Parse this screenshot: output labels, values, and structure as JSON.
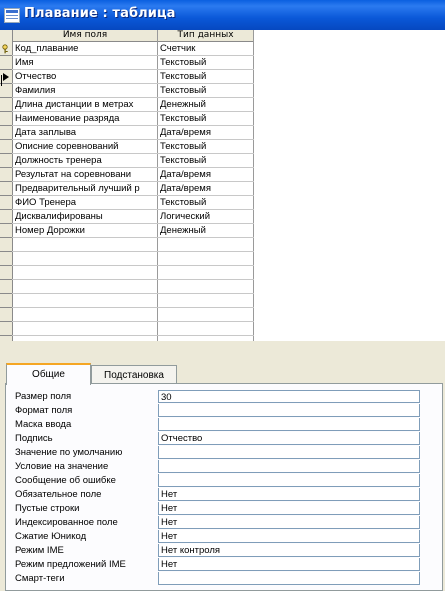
{
  "window": {
    "title": "Плавание : таблица"
  },
  "grid": {
    "columns": [
      "Имя поля",
      "Тип данных"
    ],
    "rows": [
      {
        "name": "Код_плавание",
        "type": "Счетчик"
      },
      {
        "name": "Имя",
        "type": "Текстовый"
      },
      {
        "name": "Отчество",
        "type": "Текстовый"
      },
      {
        "name": "Фамилия",
        "type": "Текстовый"
      },
      {
        "name": "Длина дистанции в метрах",
        "type": "Денежный"
      },
      {
        "name": "Наименование разряда",
        "type": "Текстовый"
      },
      {
        "name": "Дата заплыва",
        "type": "Дата/время"
      },
      {
        "name": "Описние соревнований",
        "type": "Текстовый"
      },
      {
        "name": "Должность тренера",
        "type": "Текстовый"
      },
      {
        "name": "Результат на соревновани",
        "type": "Дата/время"
      },
      {
        "name": "Предварительный лучший р",
        "type": "Дата/время"
      },
      {
        "name": "ФИО Тренера",
        "type": "Текстовый"
      },
      {
        "name": "Дисквалифированы",
        "type": "Логический"
      },
      {
        "name": "Номер Дорожки",
        "type": "Денежный"
      }
    ],
    "primary_key_row": 0,
    "current_row": 2
  },
  "tabs": {
    "general": "Общие",
    "lookup": "Подстановка"
  },
  "properties": [
    {
      "label": "Размер поля",
      "value": "30"
    },
    {
      "label": "Формат поля",
      "value": ""
    },
    {
      "label": "Маска ввода",
      "value": ""
    },
    {
      "label": "Подпись",
      "value": "Отчество"
    },
    {
      "label": "Значение по умолчанию",
      "value": ""
    },
    {
      "label": "Условие на значение",
      "value": ""
    },
    {
      "label": "Сообщение об ошибке",
      "value": ""
    },
    {
      "label": "Обязательное поле",
      "value": "Нет"
    },
    {
      "label": "Пустые строки",
      "value": "Нет"
    },
    {
      "label": "Индексированное поле",
      "value": "Нет"
    },
    {
      "label": "Сжатие Юникод",
      "value": "Нет"
    },
    {
      "label": "Режим IME",
      "value": "Нет контроля"
    },
    {
      "label": "Режим предложений IME",
      "value": "Нет"
    },
    {
      "label": "Смарт-теги",
      "value": ""
    }
  ]
}
